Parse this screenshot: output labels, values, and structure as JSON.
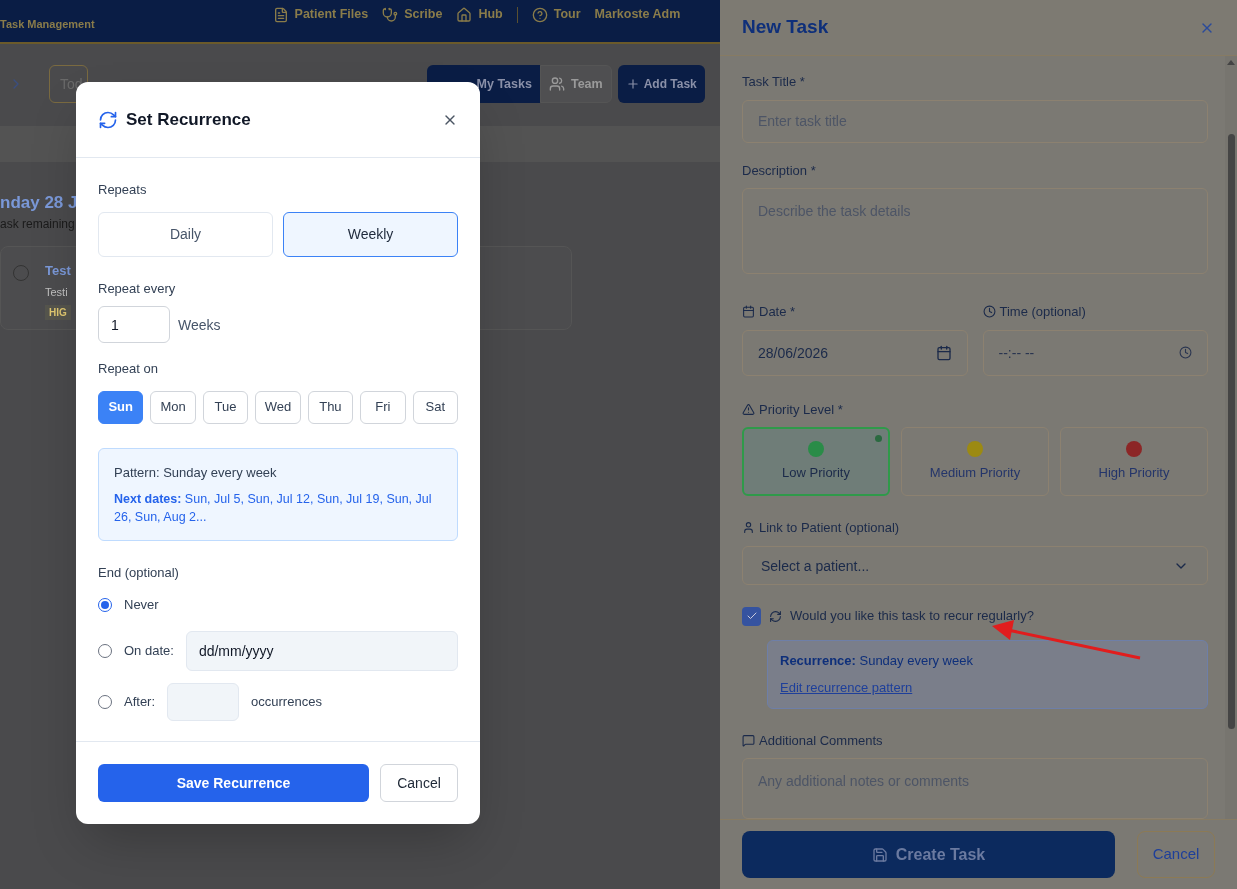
{
  "header": {
    "title": "Task Management",
    "nav": [
      {
        "label": "Patient Files",
        "kind": "files"
      },
      {
        "label": "Scribe",
        "kind": "scribe"
      },
      {
        "label": "Hub",
        "kind": "hub"
      },
      {
        "label": "Tour",
        "kind": "tour"
      }
    ],
    "user": "Markoste Adm"
  },
  "toolbar": {
    "today": "Tod",
    "views": [
      {
        "label": "My Tasks",
        "selected": true
      },
      {
        "label": "Team",
        "selected": false
      }
    ],
    "add": "Add Task"
  },
  "day": {
    "heading": "nday 28 J",
    "subtitle": "ask remaining"
  },
  "task": {
    "title": "Test",
    "description": "Testi",
    "badge": "HIG",
    "done": false
  },
  "recurrence_dialog": {
    "title": "Set Recurrence",
    "repeats_label": "Repeats",
    "repeats": [
      {
        "label": "Daily",
        "selected": false
      },
      {
        "label": "Weekly",
        "selected": true
      }
    ],
    "repeat_every_label": "Repeat every",
    "repeat_every_value": "1",
    "repeat_every_unit": "Weeks",
    "repeat_on_label": "Repeat on",
    "days": [
      {
        "label": "Sun",
        "selected": true
      },
      {
        "label": "Mon",
        "selected": false
      },
      {
        "label": "Tue",
        "selected": false
      },
      {
        "label": "Wed",
        "selected": false
      },
      {
        "label": "Thu",
        "selected": false
      },
      {
        "label": "Fri",
        "selected": false
      },
      {
        "label": "Sat",
        "selected": false
      }
    ],
    "pattern": "Pattern: Sunday every week",
    "next_dates": "**Next dates:** Sun, Jul 5, Sun, Jul 12, Sun, Jul 19, Sun, Jul 26, Sun, Aug 2...",
    "end_label": "End (optional)",
    "end_options": [
      {
        "kind": "never",
        "label": "Never",
        "selected": true
      },
      {
        "kind": "date",
        "label": "On date:",
        "placeholder": "dd/mm/yyyy",
        "selected": false
      },
      {
        "kind": "count",
        "label": "After:",
        "suffix": "occurrences",
        "selected": false
      }
    ],
    "save": "Save Recurrence",
    "cancel": "Cancel"
  },
  "new_task": {
    "title": "New Task",
    "task_title": {
      "label": "Task Title *",
      "placeholder": "Enter task title"
    },
    "description": {
      "label": "Description *",
      "placeholder": "Describe the task details"
    },
    "date": {
      "label": "Date *",
      "value": "28/06/2026"
    },
    "time": {
      "label": "Time (optional)",
      "value": "--:-- --"
    },
    "priority": {
      "label": "Priority Level *",
      "options": [
        {
          "label": "Low Priority",
          "color": "#2a8c48",
          "selected": true
        },
        {
          "label": "Medium Priority",
          "color": "#9c8a12",
          "selected": false
        },
        {
          "label": "High Priority",
          "color": "#8c2626",
          "selected": false
        }
      ]
    },
    "patient": {
      "label": "Link to Patient (optional)",
      "value": "Select a patient..."
    },
    "recur": {
      "label": "Would you like this task to recur regularly?",
      "checked": true
    },
    "recurrence_info": {
      "text": "**Recurrence:** Sunday every week",
      "link": "Edit recurrence pattern"
    },
    "comments": {
      "label": "Additional Comments",
      "placeholder": "Any additional notes or comments"
    },
    "create": "Create Task",
    "cancel": "Cancel"
  }
}
